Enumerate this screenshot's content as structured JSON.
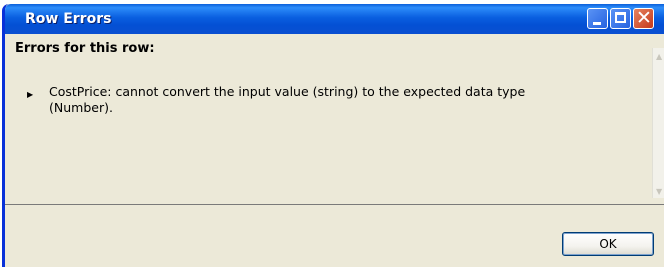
{
  "window": {
    "title": "Row Errors"
  },
  "icons": {
    "minimize": "minimize-icon",
    "maximize": "maximize-icon",
    "close": "close-icon",
    "bullet": "bullet-arrow-icon"
  },
  "dialog": {
    "heading": "Errors for this row:",
    "errors": [
      "CostPrice: cannot convert the input value (string) to the expected data type (Number)."
    ],
    "ok_label": "OK"
  },
  "colors": {
    "titlebar": "#0a5fd9",
    "window_body": "#ece9d8",
    "close_button": "#c4391c"
  }
}
